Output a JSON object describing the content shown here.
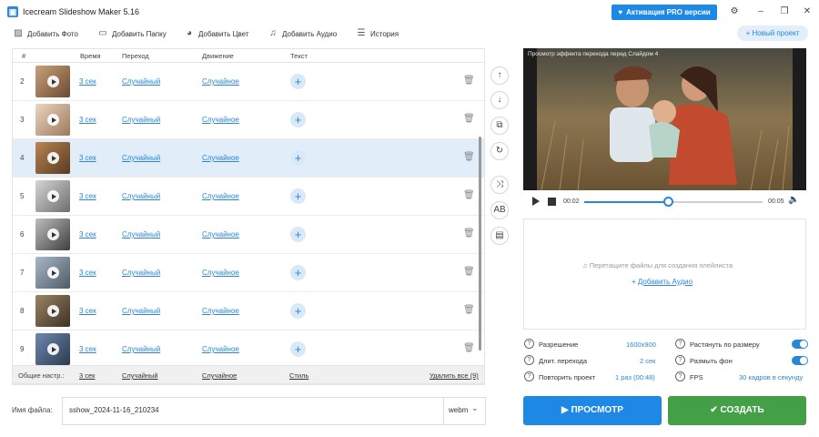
{
  "app": {
    "title": "Icecream Slideshow Maker 5.16",
    "pro_button": "Активация PRO версии",
    "new_project": "Новый проект"
  },
  "toolbar": {
    "add_photo": "Добавить Фото",
    "add_folder": "Добавить Папку",
    "add_color": "Добавить Цвет",
    "add_audio": "Добавить Аудио",
    "history": "История"
  },
  "table": {
    "headers": {
      "num": "#",
      "time": "Время",
      "transition": "Переход",
      "motion": "Движение",
      "text": "Текст"
    },
    "rows": [
      {
        "num": "2",
        "time": "3 сек",
        "transition": "Случайный",
        "motion": "Случайное"
      },
      {
        "num": "3",
        "time": "3 сек",
        "transition": "Случайный",
        "motion": "Случайное"
      },
      {
        "num": "4",
        "time": "3 сек",
        "transition": "Случайный",
        "motion": "Случайное"
      },
      {
        "num": "5",
        "time": "3 сек",
        "transition": "Случайный",
        "motion": "Случайное"
      },
      {
        "num": "6",
        "time": "3 сек",
        "transition": "Случайный",
        "motion": "Случайное"
      },
      {
        "num": "7",
        "time": "3 сек",
        "transition": "Случайный",
        "motion": "Случайное"
      },
      {
        "num": "8",
        "time": "3 сек",
        "transition": "Случайный",
        "motion": "Случайное"
      },
      {
        "num": "9",
        "time": "3 сек",
        "transition": "Случайный",
        "motion": "Случайное"
      }
    ],
    "footer": {
      "label": "Общие настр.:",
      "time": "3 сек",
      "transition": "Случайный",
      "motion": "Случайное",
      "style": "Стиль",
      "delete_all": "Удалить все (9)"
    }
  },
  "filename": {
    "label": "Имя файла:",
    "value": "sshow_2024-11-16_210234",
    "format": "webm"
  },
  "preview": {
    "caption": "Просмотр эффекта перехода перед Слайдом 4",
    "time_current": "00:02",
    "time_total": "00:05",
    "progress": 0.47
  },
  "audio": {
    "hint": "Перетащите файлы для создания плейлиста",
    "add_link": "Добавить Аудио"
  },
  "settings": {
    "resolution_label": "Разрешение",
    "resolution_value": "1600x900",
    "transition_len_label": "Длит. перехода",
    "transition_len_value": "2 сек",
    "repeat_label": "Повторить проект",
    "repeat_value": "1 раз (00:48)",
    "stretch_label": "Растянуть по размеру",
    "stretch_on": true,
    "blur_label": "Размыть фон",
    "blur_on": true,
    "fps_label": "FPS",
    "fps_value": "30 кадров в секунду"
  },
  "actions": {
    "preview": "ПРОСМОТР",
    "create": "СОЗДАТЬ"
  },
  "colors": {
    "accent": "#1e88e5",
    "create": "#43a047",
    "selected_row": "#e1eefa"
  }
}
